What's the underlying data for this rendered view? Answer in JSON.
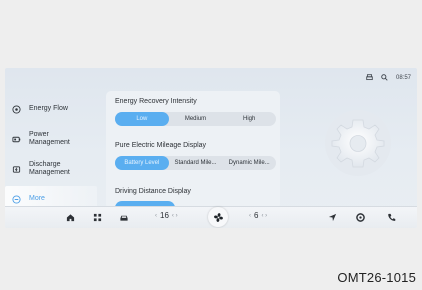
{
  "status": {
    "time": "08:57",
    "icons": [
      "printer-icon",
      "signal-icon"
    ]
  },
  "sidebar": {
    "items": [
      {
        "label": "Energy Flow",
        "icon": "energy-flow-icon",
        "active": false
      },
      {
        "label": "Power\nManagement",
        "icon": "power-icon",
        "active": false
      },
      {
        "label": "Discharge\nManagement",
        "icon": "discharge-icon",
        "active": false
      },
      {
        "label": "More",
        "icon": "more-icon",
        "active": true
      }
    ]
  },
  "panel": {
    "energy_recovery": {
      "title": "Energy Recovery Intensity",
      "options": [
        "Low",
        "Medium",
        "High"
      ],
      "selected": "Low"
    },
    "mileage_display": {
      "title": "Pure Electric Mileage Display",
      "options": [
        "Battery Level",
        "Standard Mile...",
        "Dynamic Mile..."
      ],
      "selected": "Battery Level"
    },
    "driving_distance": {
      "title": "Driving Distance Display"
    }
  },
  "dock": {
    "left_temp": {
      "value": "16"
    },
    "right_temp": {
      "value": "6"
    },
    "icons_left": [
      "home-icon",
      "apps-icon",
      "car-icon"
    ],
    "icons_right": [
      "navigation-icon",
      "settings-icon",
      "phone-icon"
    ],
    "center_icon": "fan-icon"
  },
  "caption": "OMT26-1015",
  "colors": {
    "accent": "#5aaef0",
    "screen_bg": "#e3e9ef",
    "panel_bg": "#edf1f5"
  }
}
